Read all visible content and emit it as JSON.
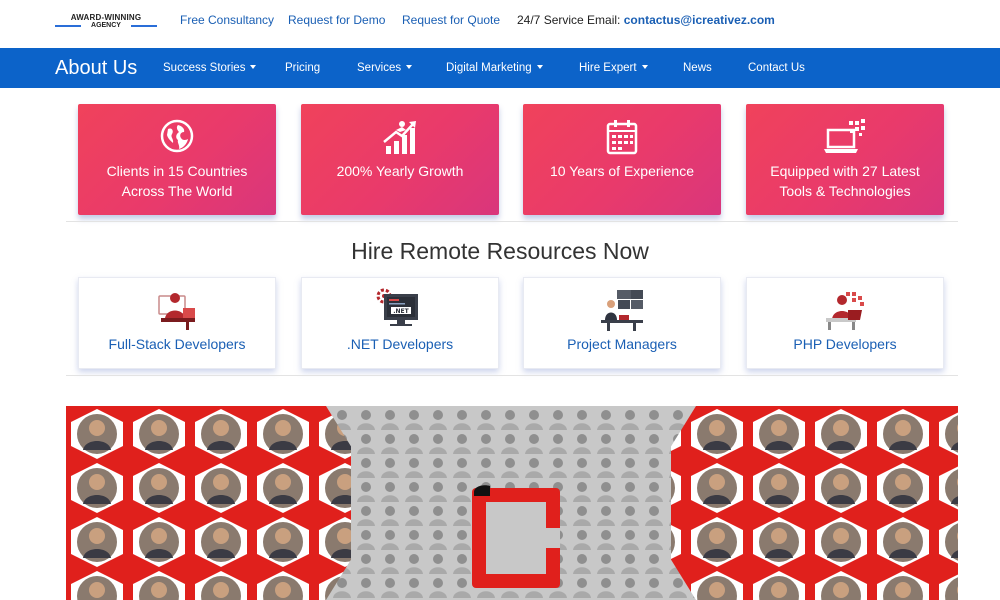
{
  "topbar": {
    "award_line1": "AWARD-WINNING",
    "award_line2": "AGENCY",
    "links": [
      "Free Consultancy",
      "Request for Demo",
      "Request for Quote"
    ],
    "service_label": "24/7 Service Email:",
    "service_email": "contactus@icreativez.com"
  },
  "nav": {
    "title": "About Us",
    "items": [
      {
        "label": "Success Stories",
        "dropdown": true
      },
      {
        "label": "Pricing",
        "dropdown": false
      },
      {
        "label": "Services",
        "dropdown": true
      },
      {
        "label": "Digital Marketing",
        "dropdown": true
      },
      {
        "label": "Hire Expert",
        "dropdown": true
      },
      {
        "label": "News",
        "dropdown": false
      },
      {
        "label": "Contact Us",
        "dropdown": false
      }
    ]
  },
  "stats": [
    {
      "icon": "globe-icon",
      "line1": "Clients in 15 Countries",
      "line2": "Across The World"
    },
    {
      "icon": "growth-chart-icon",
      "line1": "200% Yearly Growth",
      "line2": ""
    },
    {
      "icon": "calendar-icon",
      "line1": "10 Years of Experience",
      "line2": ""
    },
    {
      "icon": "laptop-tech-icon",
      "line1": "Equipped with 27 Latest",
      "line2": "Tools & Technologies"
    }
  ],
  "hire_section": {
    "title": "Hire Remote Resources Now",
    "cards": [
      {
        "icon": "full-stack-developer-icon",
        "label": "Full-Stack Developers"
      },
      {
        "icon": "dotnet-developer-icon",
        "label": ".NET Developers",
        "badge": ".NET"
      },
      {
        "icon": "project-manager-icon",
        "label": "Project Managers"
      },
      {
        "icon": "php-developer-icon",
        "label": "PHP Developers"
      }
    ]
  },
  "colors": {
    "nav_blue": "#0c63c9",
    "link_blue": "#1a5fb4",
    "card_gradient_start": "#f0425b",
    "card_gradient_end": "#d9367c",
    "brand_red": "#e0201c"
  }
}
